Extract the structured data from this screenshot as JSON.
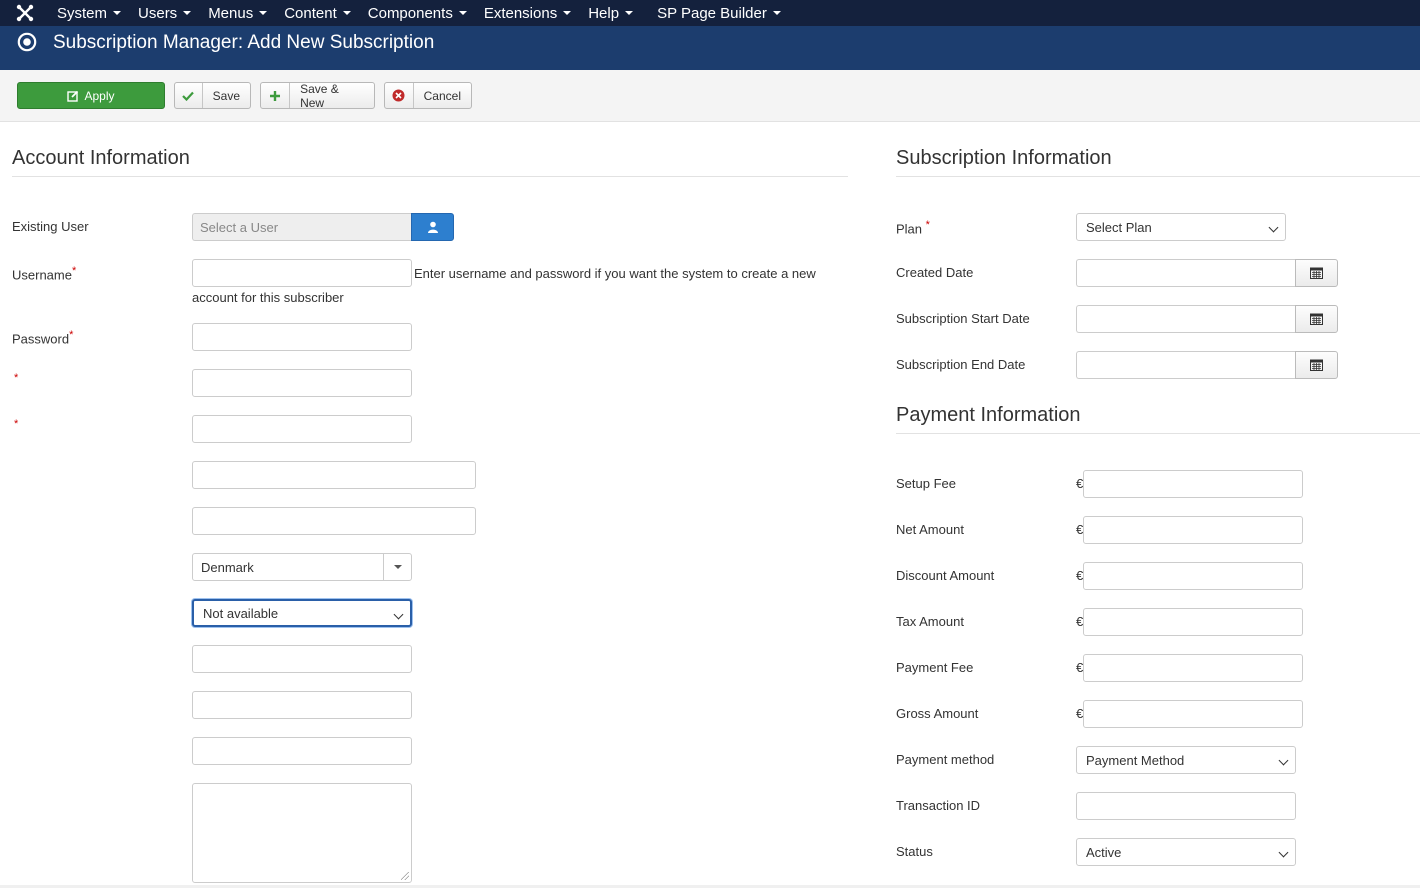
{
  "nav": {
    "items": [
      "System",
      "Users",
      "Menus",
      "Content",
      "Components",
      "Extensions",
      "Help"
    ],
    "extra": "SP Page Builder"
  },
  "header": {
    "title": "Subscription Manager: Add New Subscription"
  },
  "toolbar": {
    "apply": "Apply",
    "save": "Save",
    "save_new": "Save & New",
    "cancel": "Cancel",
    "apply_color": "#3d9b3d"
  },
  "account": {
    "title": "Account Information",
    "existing_user_label": "Existing User",
    "existing_user_placeholder": "Select a User",
    "username_label": "Username",
    "username_help": "Enter username and password if you want the system to create a new account for this subscriber",
    "password_label": "Password",
    "required_mark": "*",
    "country": "Denmark",
    "state": "Not available"
  },
  "subscription": {
    "title": "Subscription Information",
    "plan_label": "Plan",
    "plan_value": "Select Plan",
    "created_label": "Created Date",
    "start_label": "Subscription Start Date",
    "end_label": "Subscription End Date"
  },
  "payment": {
    "title": "Payment Information",
    "currency": "€",
    "setup_fee": "Setup Fee",
    "net_amount": "Net Amount",
    "discount_amount": "Discount Amount",
    "tax_amount": "Tax Amount",
    "payment_fee": "Payment Fee",
    "gross_amount": "Gross Amount",
    "method_label": "Payment method",
    "method_value": "Payment Method",
    "transaction_label": "Transaction ID",
    "status_label": "Status",
    "status_value": "Active"
  },
  "icons": {
    "logo": "joomla-icon",
    "title": "target-icon",
    "apply": "edit-icon",
    "save": "check-icon",
    "save_new": "plus-icon",
    "cancel": "cancel-icon",
    "user": "user-icon",
    "calendar": "calendar-icon"
  }
}
